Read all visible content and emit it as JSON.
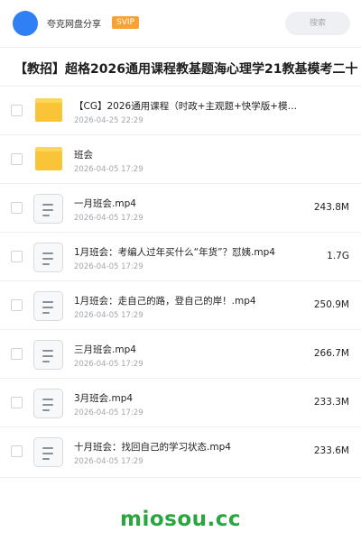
{
  "header": {
    "site_name": "夸克网盘分享",
    "badge": "SVIP",
    "search_label": "搜索",
    "avatar_color": "#2f7ff5",
    "badge_color": "#f7a234"
  },
  "share_title": "【教招】超格2026通用课程教基题海心理学21教基模考二十",
  "files": [
    {
      "type": "folder",
      "icon": "folder-icon",
      "name": "【CG】2026通用课程（时政+主观题+快学版+模…",
      "date": "2026-04-25 22:29",
      "size": ""
    },
    {
      "type": "folder",
      "icon": "folder-icon",
      "name": "班会",
      "date": "2026-04-05 17:29",
      "size": ""
    },
    {
      "type": "video",
      "icon": "file-icon",
      "name": "一月班会.mp4",
      "date": "2026-04-05 17:29",
      "size": "243.8M"
    },
    {
      "type": "video",
      "icon": "file-icon",
      "name": "1月班会：考编人过年买什么“年货”？怼姨.mp4",
      "date": "2026-04-05 17:29",
      "size": "1.7G"
    },
    {
      "type": "video",
      "icon": "file-icon",
      "name": "1月班会：走自己的路，登自己的岸！.mp4",
      "date": "2026-04-05 17:29",
      "size": "250.9M"
    },
    {
      "type": "video",
      "icon": "file-icon",
      "name": "三月班会.mp4",
      "date": "2026-04-05 17:29",
      "size": "266.7M"
    },
    {
      "type": "video",
      "icon": "file-icon",
      "name": "3月班会.mp4",
      "date": "2026-04-05 17:29",
      "size": "233.3M"
    },
    {
      "type": "video",
      "icon": "file-icon",
      "name": "十月班会：找回自己的学习状态.mp4",
      "date": "2026-04-05 17:29",
      "size": "233.6M"
    }
  ],
  "watermark": "miosou.cc",
  "watermark_color": "#2aa63f"
}
